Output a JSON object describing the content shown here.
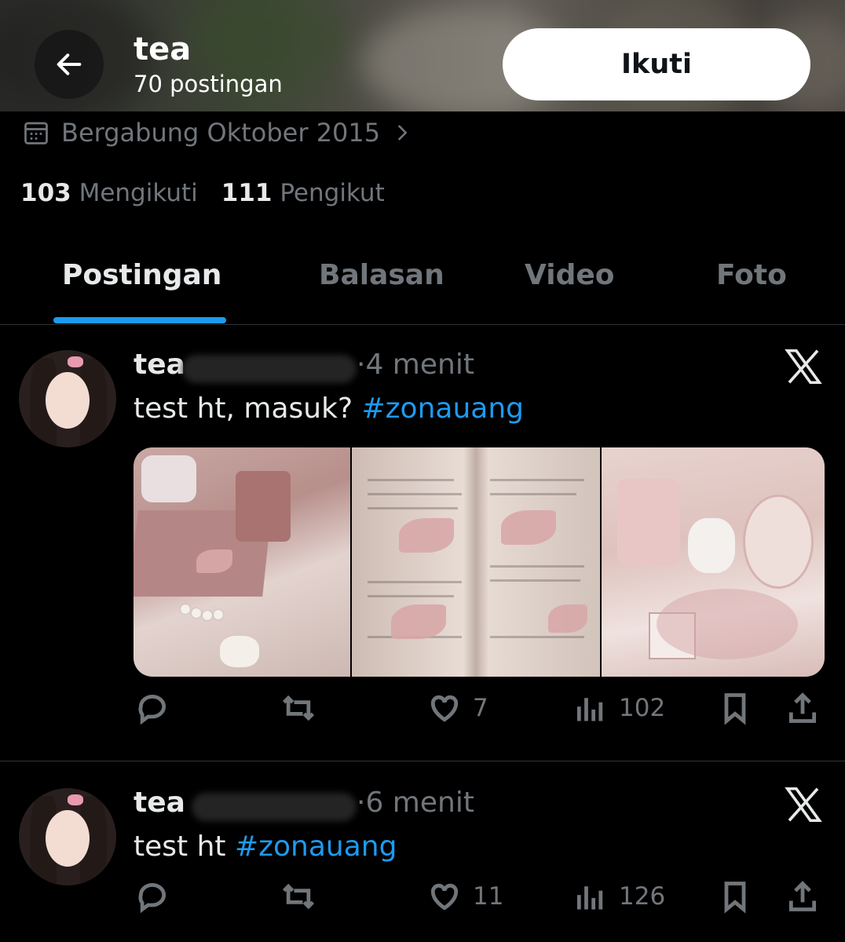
{
  "header": {
    "back_icon": "arrow-left-icon",
    "name": "tea",
    "post_count": "70 postingan",
    "follow_label": "Ikuti"
  },
  "profile": {
    "calendar_icon": "calendar-icon",
    "joined": "Bergabung Oktober 2015",
    "following_count": "103",
    "following_label": "Mengikuti",
    "followers_count": "111",
    "followers_label": "Pengikut"
  },
  "tabs": [
    {
      "label": "Postingan",
      "active": true
    },
    {
      "label": "Balasan",
      "active": false
    },
    {
      "label": "Video",
      "active": false
    },
    {
      "label": "Foto",
      "active": false
    }
  ],
  "colors": {
    "accent": "#1d9bf0",
    "background": "#000000",
    "muted": "#71767b"
  },
  "posts": [
    {
      "name": "tea",
      "time": "·4 menit",
      "text": "test ht, masuk? ",
      "hashtag": "#zonauang",
      "likes": "7",
      "views": "102"
    },
    {
      "name": "tea",
      "time": "·6 menit",
      "text": "test ht ",
      "hashtag": "#zonauang",
      "likes": "11",
      "views": "126"
    }
  ]
}
